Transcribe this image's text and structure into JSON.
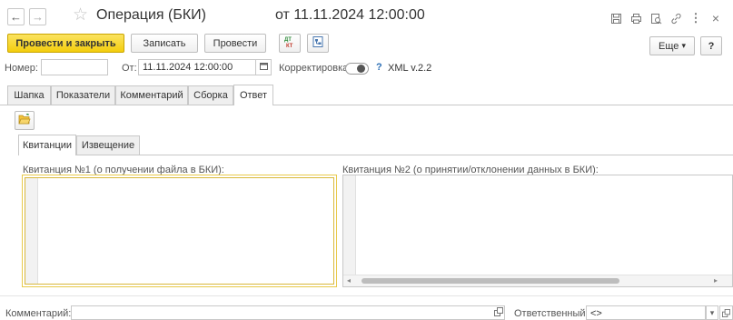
{
  "window": {
    "title": "Операция (БКИ)",
    "date": "от 11.11.2024 12:00:00",
    "back_glyph": "←",
    "forward_glyph": "→",
    "star_glyph": "☆",
    "more_glyph": "⋮",
    "close_glyph": "×"
  },
  "toolbar": {
    "post_and_close": "Провести и закрыть",
    "save": "Записать",
    "post": "Провести",
    "more": "Еще",
    "more_arrow": "▾",
    "help": "?"
  },
  "form": {
    "number_label": "Номер:",
    "number_value": "",
    "date_label": "От:",
    "date_value": "11.11.2024 12:00:00",
    "correction_label": "Корректировка:",
    "help_glyph": "?",
    "xml_version": "XML v.2.2"
  },
  "tabs": [
    {
      "label": "Шапка"
    },
    {
      "label": "Показатели"
    },
    {
      "label": "Комментарий"
    },
    {
      "label": "Сборка"
    },
    {
      "label": "Ответ"
    }
  ],
  "subtabs": [
    {
      "label": "Квитанции"
    },
    {
      "label": "Извещение"
    }
  ],
  "panels": {
    "receipt1_title": "Квитанция №1 (о получении файла в БКИ):",
    "receipt2_title": "Квитанция №2 (о принятии/отклонении данных в БКИ):",
    "scroll_left": "◂",
    "scroll_right": "▸"
  },
  "footer": {
    "comment_label": "Комментарий:",
    "comment_value": "",
    "responsible_label": "Ответственный:",
    "responsible_value": "<>",
    "dropdown_glyph": "▾"
  },
  "colors": {
    "primary_button": "#f3cd0d",
    "active_field_border": "#e8c94a",
    "link_blue": "#2c6fb5"
  }
}
